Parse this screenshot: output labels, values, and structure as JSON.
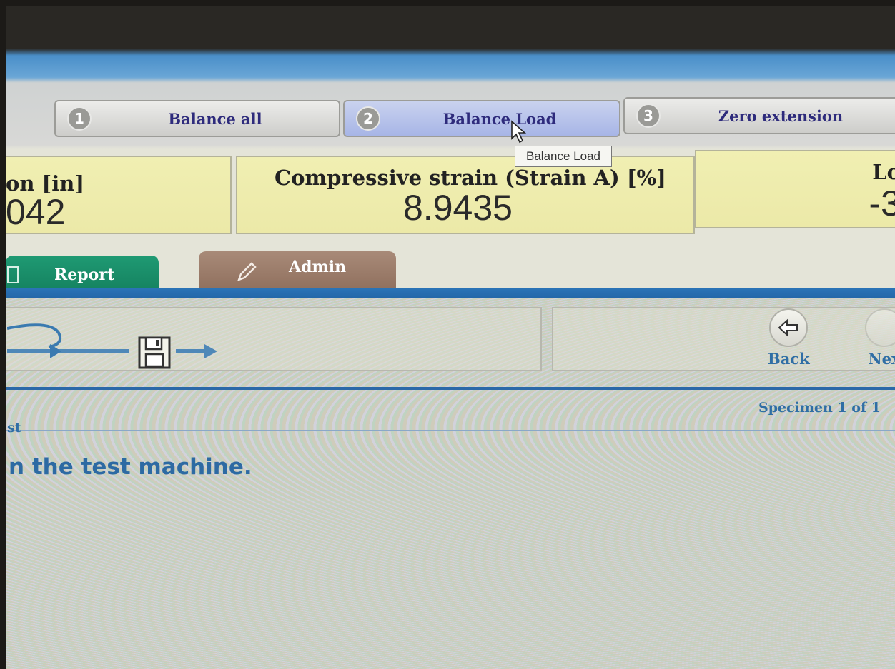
{
  "toolbar": {
    "buttons": [
      {
        "num": "1",
        "label": "Balance all"
      },
      {
        "num": "2",
        "label": "Balance Load"
      },
      {
        "num": "3",
        "label": "Zero extension"
      }
    ],
    "tooltip": "Balance Load"
  },
  "readouts": [
    {
      "label": "on [in]",
      "value": "042"
    },
    {
      "label": "Compressive strain (Strain A) [%]",
      "value": "8.9435"
    },
    {
      "label": "Lo",
      "value": "-3"
    }
  ],
  "tabs": {
    "report": "Report",
    "admin": "Admin"
  },
  "nav": {
    "back": "Back",
    "next": "Nex"
  },
  "workflow": {
    "specimen": "Specimen 1 of 1",
    "step_title": "st",
    "instruction": "n the test machine."
  },
  "colors": {
    "readout_bg": "#f0efb2",
    "tab_report": "#1f9a73",
    "tab_admin": "#a88a78",
    "accent_blue": "#2b74b8",
    "label_text": "#2e2b7c"
  }
}
